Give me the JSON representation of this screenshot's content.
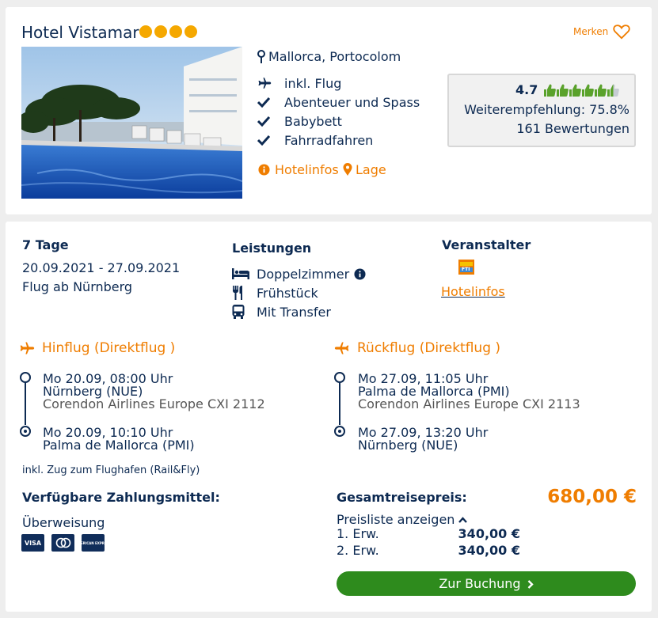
{
  "hotel": {
    "name": "Hotel Vistamar",
    "stars": 4,
    "merken_label": "Merken",
    "location": "Mallorca, Portocolom",
    "features": [
      "inkl. Flug",
      "Abenteuer und Spass",
      "Babybett",
      "Fahrradfahren"
    ],
    "hotelinfos_label": "Hotelinfos",
    "lage_label": "Lage"
  },
  "rating": {
    "score": "4.7",
    "thumbs_filled": 5.5,
    "thumbs_total": 6,
    "recommendation": "Weiterempfehlung: 75.8%",
    "reviews": "161 Bewertungen"
  },
  "trip": {
    "duration": "7 Tage",
    "dates": "20.09.2021 - 27.09.2021",
    "departure": "Flug ab Nürnberg"
  },
  "services": {
    "title": "Leistungen",
    "items": [
      {
        "icon": "bed-icon",
        "label": "Doppelzimmer"
      },
      {
        "icon": "cutlery-icon",
        "label": "Frühstück"
      },
      {
        "icon": "bus-icon",
        "label": "Mit Transfer"
      }
    ]
  },
  "operator": {
    "title": "Veranstalter",
    "link": "Hotelinfos"
  },
  "outbound": {
    "title": "Hinflug (Direktflug )",
    "dep_time": "Mo 20.09, 08:00 Uhr",
    "dep_airport": "Nürnberg (NUE)",
    "airline": "Corendon Airlines Europe CXI 2112",
    "arr_time": "Mo 20.09, 10:10 Uhr",
    "arr_airport": "Palma de Mallorca (PMI)"
  },
  "return": {
    "title": "Rückflug (Direktflug )",
    "dep_time": "Mo 27.09, 11:05 Uhr",
    "dep_airport": "Palma de Mallorca (PMI)",
    "airline": "Corendon Airlines Europe CXI 2113",
    "arr_time": "Mo 27.09, 13:20 Uhr",
    "arr_airport": "Nürnberg (NUE)"
  },
  "rail_note": "inkl. Zug zum Flughafen (Rail&Fly)",
  "payment": {
    "title": "Verfügbare Zahlungsmittel:",
    "method": "Überweisung",
    "cards": [
      "VISA",
      "mastercard",
      "AMERICAN EXPRESS"
    ]
  },
  "price": {
    "title": "Gesamtreisepreis:",
    "total": "680,00 €",
    "list_label": "Preisliste anzeigen",
    "rows": [
      {
        "label": "1. Erw.",
        "value": "340,00 €"
      },
      {
        "label": "2. Erw.",
        "value": "340,00 €"
      }
    ],
    "book_label": "Zur Buchung"
  },
  "colors": {
    "orange": "#ef7d00",
    "navy": "#0d2a52",
    "green": "#2e8b1d",
    "star": "#f5a800"
  }
}
